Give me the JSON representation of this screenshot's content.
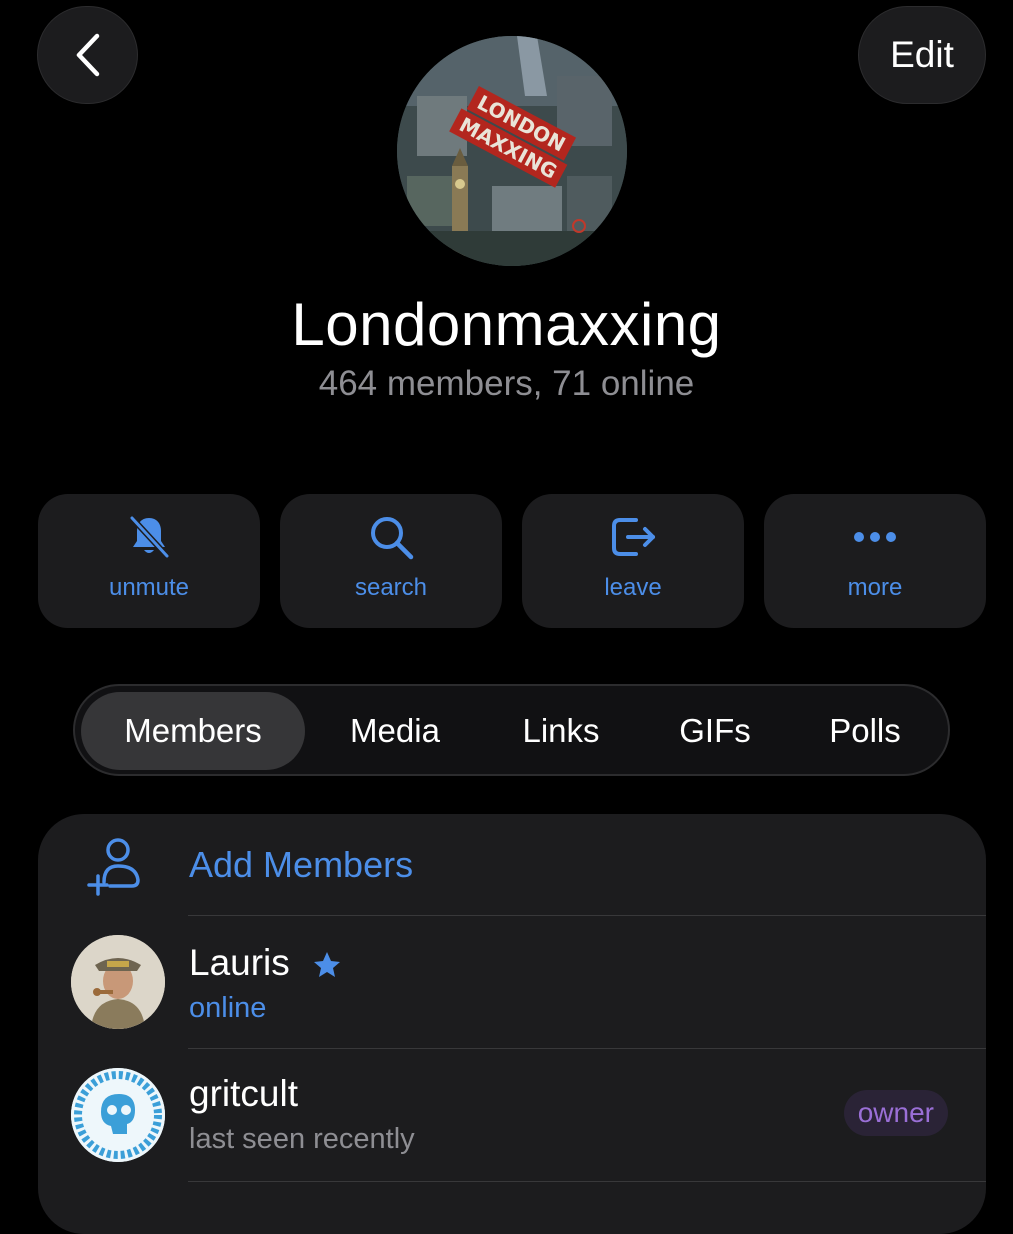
{
  "header": {
    "edit_label": "Edit"
  },
  "group": {
    "name": "Londonmaxxing",
    "subtitle": "464 members, 71 online",
    "avatar_text": [
      "LONDON",
      "MAXXING"
    ]
  },
  "actions": [
    {
      "label": "unmute",
      "icon": "bell-slash-icon"
    },
    {
      "label": "search",
      "icon": "magnifier-icon"
    },
    {
      "label": "leave",
      "icon": "leave-arrow-icon"
    },
    {
      "label": "more",
      "icon": "ellipsis-icon"
    }
  ],
  "tabs": [
    {
      "label": "Members",
      "active": true
    },
    {
      "label": "Media",
      "active": false
    },
    {
      "label": "Links",
      "active": false
    },
    {
      "label": "GIFs",
      "active": false
    },
    {
      "label": "Polls",
      "active": false
    }
  ],
  "members_list": {
    "add_label": "Add Members",
    "items": [
      {
        "name": "Lauris",
        "status": "online",
        "status_color": "#4c8ee8",
        "starred": true,
        "badge": ""
      },
      {
        "name": "gritcult",
        "status": "last seen recently",
        "status_color": "#8e8e93",
        "starred": false,
        "badge": "owner"
      }
    ]
  },
  "colors": {
    "accent": "#4c8ee8",
    "background": "#000000",
    "card": "#1c1c1e",
    "secondary_text": "#8e8e93",
    "owner_badge": "#9a6fd6"
  }
}
